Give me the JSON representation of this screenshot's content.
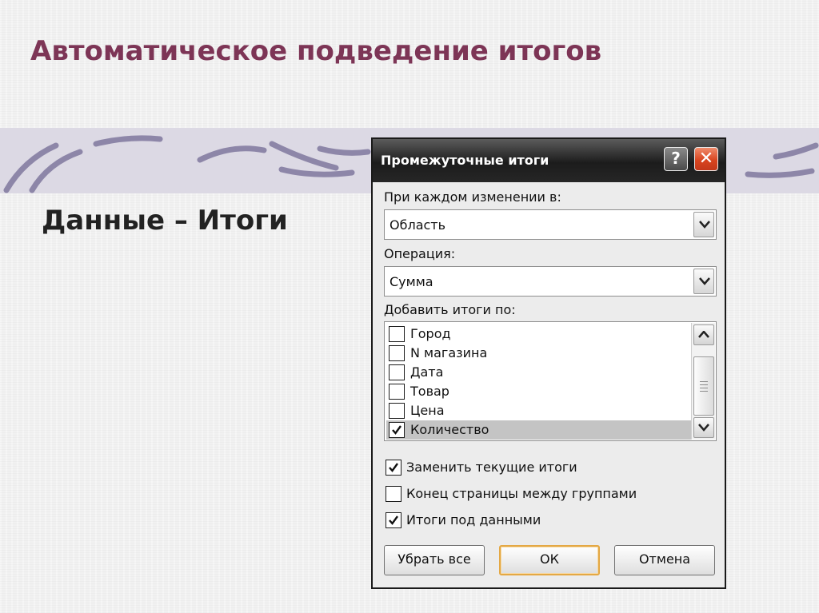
{
  "slide": {
    "title": "Автоматическое подведение итогов",
    "subtitle": "Данные – Итоги"
  },
  "dialog": {
    "title": "Промежуточные итоги",
    "help_label": "?",
    "close_label": "✕",
    "group_by_label": "При каждом изменении в:",
    "group_by_value": "Область",
    "operation_label": "Операция:",
    "operation_value": "Сумма",
    "add_totals_label": "Добавить итоги по:",
    "columns": [
      {
        "label": "Город",
        "checked": false
      },
      {
        "label": "N магазина",
        "checked": false
      },
      {
        "label": "Дата",
        "checked": false
      },
      {
        "label": "Товар",
        "checked": false
      },
      {
        "label": " Цена",
        "checked": false
      },
      {
        "label": "Количество",
        "checked": true
      }
    ],
    "options": [
      {
        "label": "Заменить текущие итоги",
        "checked": true
      },
      {
        "label": "Конец страницы между группами",
        "checked": false
      },
      {
        "label": "Итоги под данными",
        "checked": true
      }
    ],
    "buttons": {
      "remove_all": "Убрать все",
      "ok": "ОК",
      "cancel": "Отмена"
    }
  },
  "colors": {
    "title": "#7d3556",
    "band": "#dcd9e4",
    "close": "#d9451f",
    "default_button_border": "#e4a844"
  }
}
